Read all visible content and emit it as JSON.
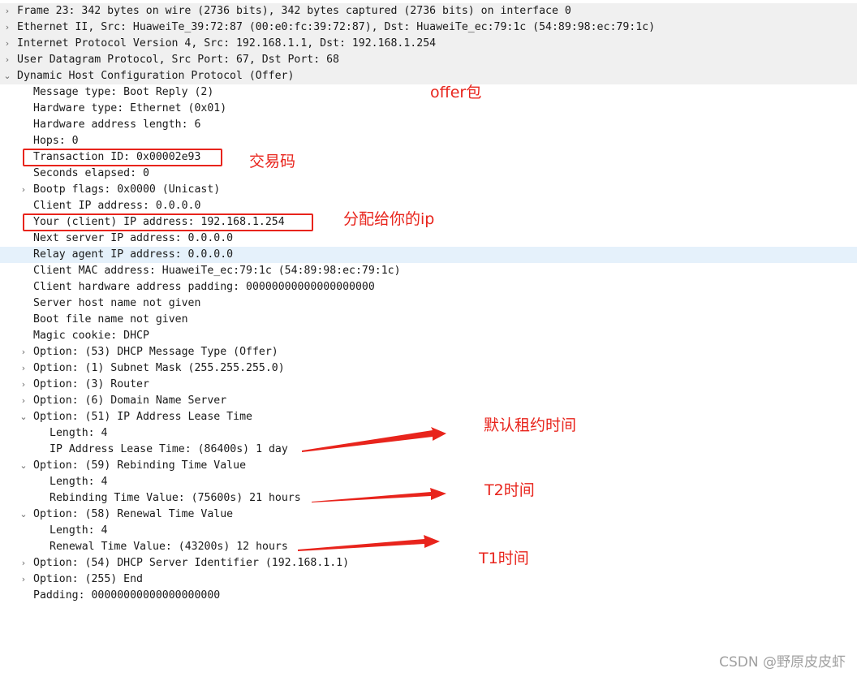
{
  "packet_details": {
    "rows": [
      {
        "level": 0,
        "toggle": "›",
        "text": "Frame 23: 342 bytes on wire (2736 bits), 342 bytes captured (2736 bits) on interface 0",
        "state": "collapsed"
      },
      {
        "level": 0,
        "toggle": "›",
        "text": "Ethernet II, Src: HuaweiTe_39:72:87 (00:e0:fc:39:72:87), Dst: HuaweiTe_ec:79:1c (54:89:98:ec:79:1c)",
        "state": "collapsed"
      },
      {
        "level": 0,
        "toggle": "›",
        "text": "Internet Protocol Version 4, Src: 192.168.1.1, Dst: 192.168.1.254",
        "state": "collapsed"
      },
      {
        "level": 0,
        "toggle": "›",
        "text": "User Datagram Protocol, Src Port: 67, Dst Port: 68",
        "state": "collapsed"
      },
      {
        "level": 0,
        "toggle": "⌄",
        "text": "Dynamic Host Configuration Protocol (Offer)",
        "state": "expanded"
      },
      {
        "level": 1,
        "toggle": "",
        "text": "Message type: Boot Reply (2)",
        "state": "leaf"
      },
      {
        "level": 1,
        "toggle": "",
        "text": "Hardware type: Ethernet (0x01)",
        "state": "leaf"
      },
      {
        "level": 1,
        "toggle": "",
        "text": "Hardware address length: 6",
        "state": "leaf"
      },
      {
        "level": 1,
        "toggle": "",
        "text": "Hops: 0",
        "state": "leaf"
      },
      {
        "level": 1,
        "toggle": "",
        "text": "Transaction ID: 0x00002e93",
        "state": "leaf"
      },
      {
        "level": 1,
        "toggle": "",
        "text": "Seconds elapsed: 0",
        "state": "leaf"
      },
      {
        "level": 1,
        "toggle": "›",
        "text": "Bootp flags: 0x0000 (Unicast)",
        "state": "collapsed"
      },
      {
        "level": 1,
        "toggle": "",
        "text": "Client IP address: 0.0.0.0",
        "state": "leaf"
      },
      {
        "level": 1,
        "toggle": "",
        "text": "Your (client) IP address: 192.168.1.254",
        "state": "leaf"
      },
      {
        "level": 1,
        "toggle": "",
        "text": "Next server IP address: 0.0.0.0",
        "state": "leaf"
      },
      {
        "level": 1,
        "toggle": "",
        "text": "Relay agent IP address: 0.0.0.0",
        "state": "selected"
      },
      {
        "level": 1,
        "toggle": "",
        "text": "Client MAC address: HuaweiTe_ec:79:1c (54:89:98:ec:79:1c)",
        "state": "leaf"
      },
      {
        "level": 1,
        "toggle": "",
        "text": "Client hardware address padding: 00000000000000000000",
        "state": "leaf"
      },
      {
        "level": 1,
        "toggle": "",
        "text": "Server host name not given",
        "state": "leaf"
      },
      {
        "level": 1,
        "toggle": "",
        "text": "Boot file name not given",
        "state": "leaf"
      },
      {
        "level": 1,
        "toggle": "",
        "text": "Magic cookie: DHCP",
        "state": "leaf"
      },
      {
        "level": 1,
        "toggle": "›",
        "text": "Option: (53) DHCP Message Type (Offer)",
        "state": "collapsed"
      },
      {
        "level": 1,
        "toggle": "›",
        "text": "Option: (1) Subnet Mask (255.255.255.0)",
        "state": "collapsed"
      },
      {
        "level": 1,
        "toggle": "›",
        "text": "Option: (3) Router",
        "state": "collapsed"
      },
      {
        "level": 1,
        "toggle": "›",
        "text": "Option: (6) Domain Name Server",
        "state": "collapsed"
      },
      {
        "level": 1,
        "toggle": "⌄",
        "text": "Option: (51) IP Address Lease Time",
        "state": "expanded"
      },
      {
        "level": 2,
        "toggle": "",
        "text": "Length: 4",
        "state": "leaf"
      },
      {
        "level": 2,
        "toggle": "",
        "text": "IP Address Lease Time: (86400s) 1 day",
        "state": "leaf"
      },
      {
        "level": 1,
        "toggle": "⌄",
        "text": "Option: (59) Rebinding Time Value",
        "state": "expanded"
      },
      {
        "level": 2,
        "toggle": "",
        "text": "Length: 4",
        "state": "leaf"
      },
      {
        "level": 2,
        "toggle": "",
        "text": "Rebinding Time Value: (75600s) 21 hours",
        "state": "leaf"
      },
      {
        "level": 1,
        "toggle": "⌄",
        "text": "Option: (58) Renewal Time Value",
        "state": "expanded"
      },
      {
        "level": 2,
        "toggle": "",
        "text": "Length: 4",
        "state": "leaf"
      },
      {
        "level": 2,
        "toggle": "",
        "text": "Renewal Time Value: (43200s) 12 hours",
        "state": "leaf"
      },
      {
        "level": 1,
        "toggle": "›",
        "text": "Option: (54) DHCP Server Identifier (192.168.1.1)",
        "state": "collapsed"
      },
      {
        "level": 1,
        "toggle": "›",
        "text": "Option: (255) End",
        "state": "collapsed"
      },
      {
        "level": 1,
        "toggle": "",
        "text": "Padding: 00000000000000000000",
        "state": "leaf"
      }
    ]
  },
  "annotations": {
    "offer_packet": "offer包",
    "transaction_code": "交易码",
    "assigned_ip": "分配给你的ip",
    "default_lease_time": "默认租约时间",
    "t2_time": "T2时间",
    "t1_time": "T1时间",
    "color": "#e8241c"
  },
  "watermark": "CSDN @野原皮皮虾",
  "colors": {
    "selected_row": "#e5f1fb",
    "header_row": "#f0f0f0",
    "annotation_red": "#e8241c"
  }
}
